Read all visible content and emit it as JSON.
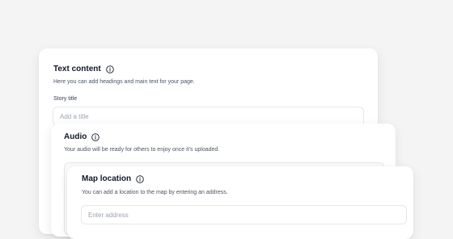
{
  "text_content": {
    "title": "Text content",
    "icon": "info-icon",
    "description": "Here you can add headings and main text for your page.",
    "story_title_label": "Story title",
    "story_title_placeholder": "Add a title",
    "story_title_value": ""
  },
  "audio": {
    "title": "Audio",
    "icon": "info-icon",
    "description": "Your audio will be ready for others to enjoy once it’s uploaded."
  },
  "map_location": {
    "title": "Map location",
    "icon": "info-icon",
    "description": "You can add a location to the map by entering an address.",
    "address_placeholder": "Enter address",
    "address_value": ""
  }
}
